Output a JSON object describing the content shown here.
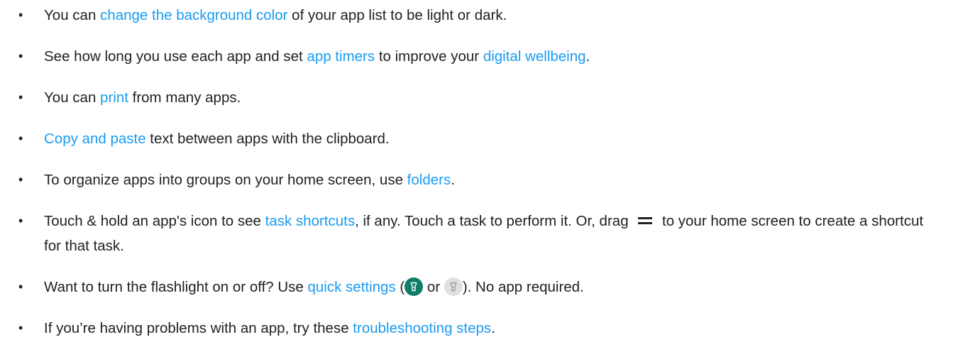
{
  "tips": [
    {
      "pre": "You can ",
      "link": "change the background color",
      "post": " of your app list to be light or dark."
    },
    {
      "pre": "See how long you use each app and set ",
      "link1": "app timers",
      "mid": " to improve your ",
      "link2": "digital wellbeing",
      "post": "."
    },
    {
      "pre": "You can ",
      "link": "print",
      "post": " from many apps."
    },
    {
      "link": "Copy and paste",
      "post": " text between apps with the clipboard."
    },
    {
      "pre": "To organize apps into groups on your home screen, use ",
      "link": "folders",
      "post": "."
    },
    {
      "pre": "Touch & hold an app's icon to see ",
      "link": "task shortcuts",
      "mid": ", if any. Touch a task to perform it. Or, drag ",
      "post": " to your home screen to create a shortcut for that task."
    },
    {
      "pre": "Want to turn the flashlight on or off? Use ",
      "link": "quick settings",
      "open": " (",
      "or": " or ",
      "close": "). No app required."
    },
    {
      "pre": "If you’re having problems with an app, try these ",
      "link": "troubleshooting steps",
      "post": "."
    }
  ],
  "bullet": "•",
  "icons": {
    "drag_handle": "drag-handle-icon",
    "flashlight_on": "flashlight-on-icon",
    "flashlight_off": "flashlight-off-icon"
  },
  "colors": {
    "link": "#1a9bf0",
    "text": "#202124",
    "flashlight_on_bg": "#107c6a",
    "flashlight_off_bg": "#e0e0e0"
  }
}
